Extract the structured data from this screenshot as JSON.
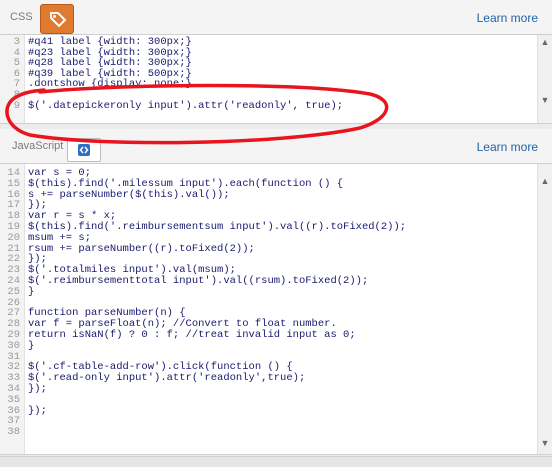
{
  "css_panel": {
    "label": "CSS",
    "tab_icon": "tag-icon",
    "learn_more": "Learn more",
    "lines": [
      {
        "num": "3",
        "text": "#q41 label {width: 300px;}"
      },
      {
        "num": "4",
        "text": "#q23 label {width: 300px;}"
      },
      {
        "num": "5",
        "text": "#q28 label {width: 300px;}"
      },
      {
        "num": "6",
        "text": "#q39 label {width: 500px;}"
      },
      {
        "num": "7",
        "text": ".dontshow {display: none;}"
      },
      {
        "num": "8",
        "text": ""
      },
      {
        "num": "9",
        "text": "$('.datepickeronly input').attr('readonly', true);"
      }
    ]
  },
  "js_panel": {
    "label": "JavaScript",
    "tab_icon": "code-brackets-icon",
    "learn_more": "Learn more",
    "lines": [
      {
        "num": "14",
        "text": "var s = 0;"
      },
      {
        "num": "15",
        "text": "$(this).find('.milessum input').each(function () {"
      },
      {
        "num": "16",
        "text": "s += parseNumber($(this).val());"
      },
      {
        "num": "17",
        "text": "});"
      },
      {
        "num": "18",
        "text": "var r = s * x;"
      },
      {
        "num": "19",
        "text": "$(this).find('.reimbursementsum input').val((r).toFixed(2));"
      },
      {
        "num": "20",
        "text": "msum += s;"
      },
      {
        "num": "21",
        "text": "rsum += parseNumber((r).toFixed(2));"
      },
      {
        "num": "22",
        "text": "});"
      },
      {
        "num": "23",
        "text": "$('.totalmiles input').val(msum);"
      },
      {
        "num": "24",
        "text": "$('.reimbursementtotal input').val((rsum).toFixed(2));"
      },
      {
        "num": "25",
        "text": "}"
      },
      {
        "num": "26",
        "text": ""
      },
      {
        "num": "27",
        "text": "function parseNumber(n) {"
      },
      {
        "num": "28",
        "text": "var f = parseFloat(n); //Convert to float number."
      },
      {
        "num": "29",
        "text": "return isNaN(f) ? 0 : f; //treat invalid input as 0;"
      },
      {
        "num": "30",
        "text": "}"
      },
      {
        "num": "31",
        "text": ""
      },
      {
        "num": "32",
        "text": "$('.cf-table-add-row').click(function () {"
      },
      {
        "num": "33",
        "text": "$('.read-only input').attr('readonly',true);"
      },
      {
        "num": "34",
        "text": "});"
      },
      {
        "num": "35",
        "text": ""
      },
      {
        "num": "36",
        "text": "});"
      },
      {
        "num": "37",
        "text": ""
      },
      {
        "num": "38",
        "text": ""
      }
    ]
  },
  "colors": {
    "accent": "#e07a2e",
    "link": "#2162a8",
    "annotation": "#e8141e"
  }
}
